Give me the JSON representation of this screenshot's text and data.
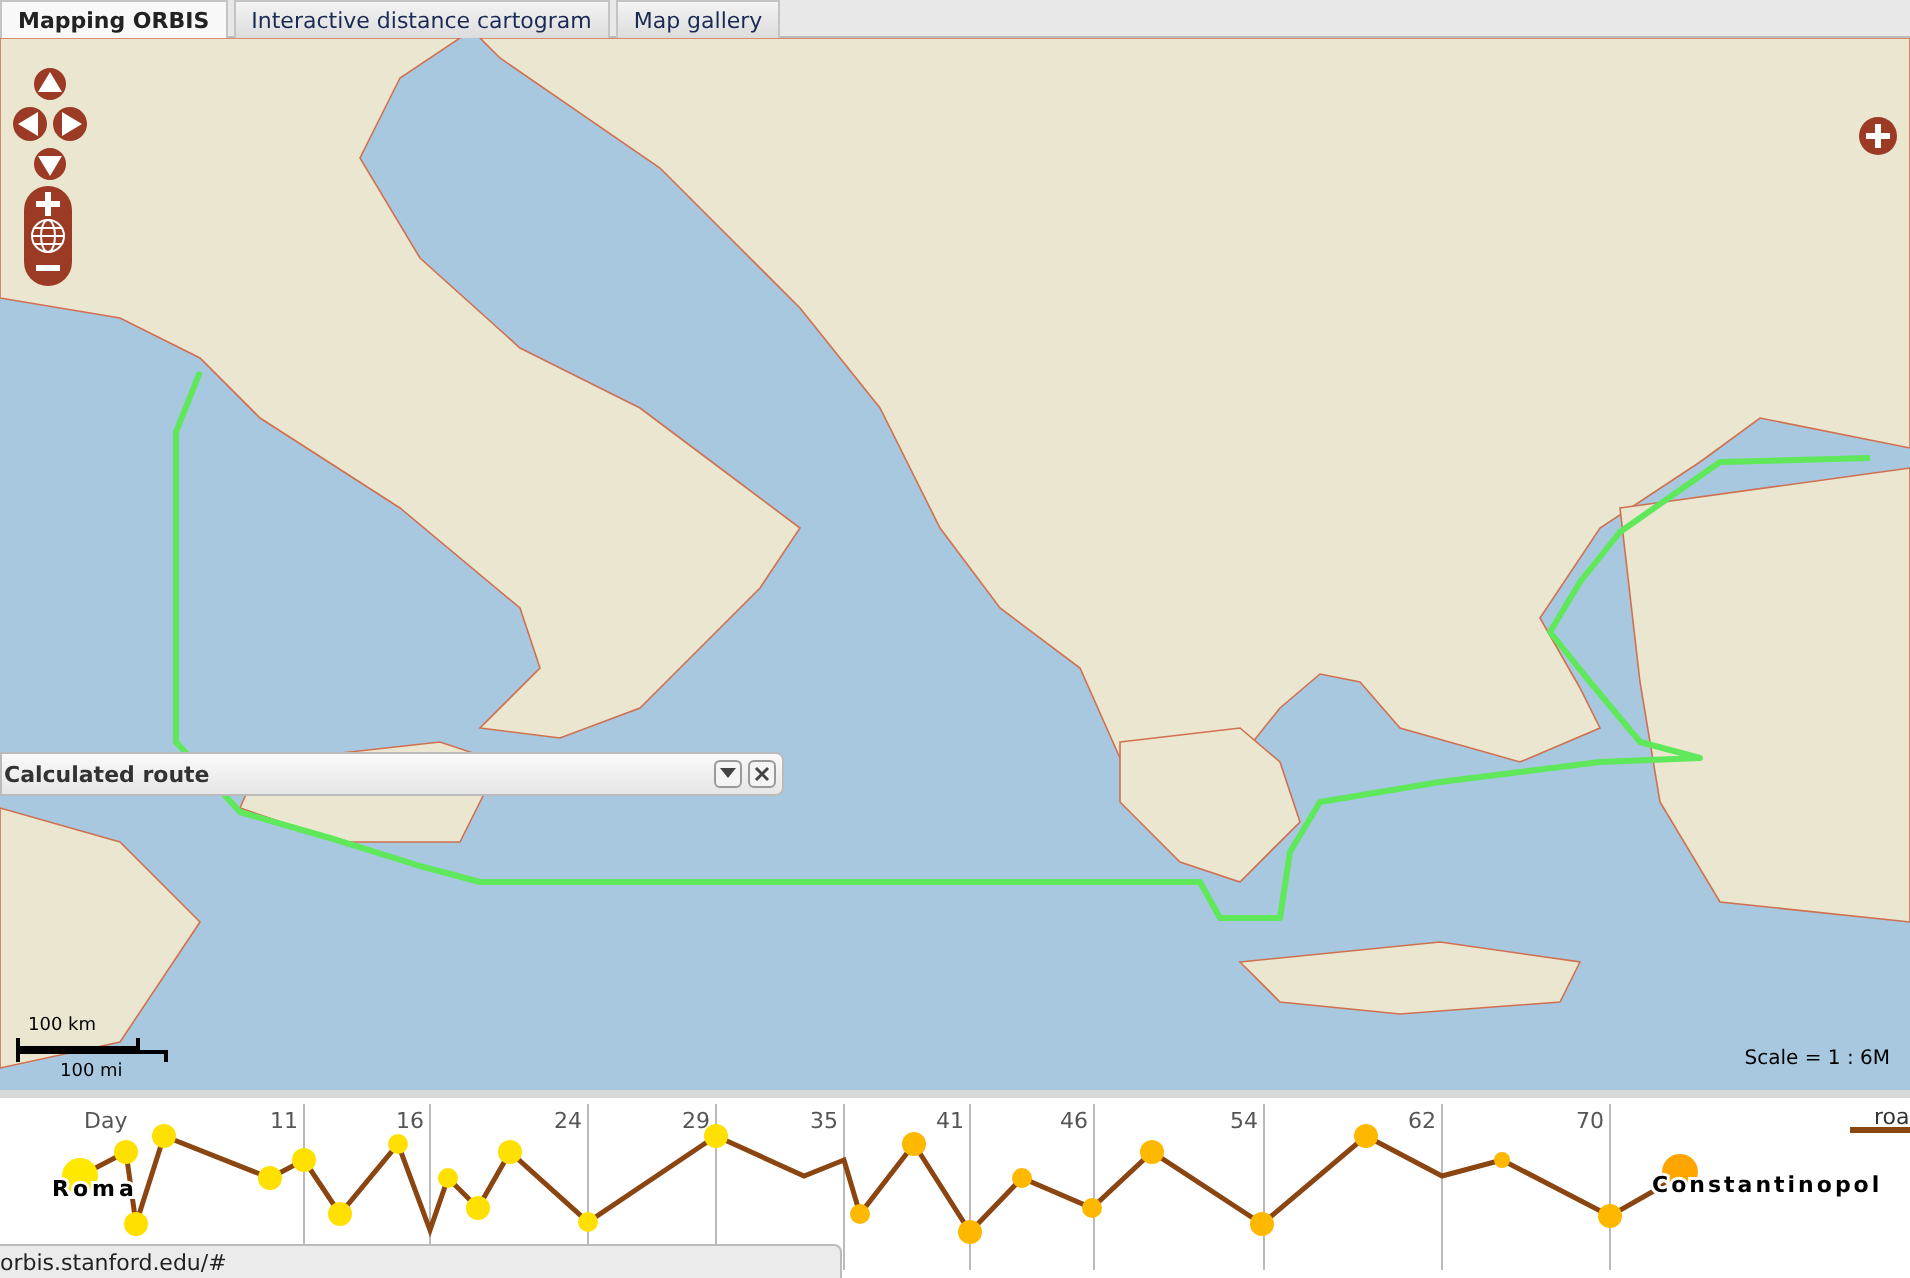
{
  "tabs": [
    {
      "label": "Mapping ORBIS",
      "selected": true
    },
    {
      "label": "Interactive distance cartogram",
      "selected": false
    },
    {
      "label": "Map gallery",
      "selected": false
    }
  ],
  "map": {
    "route_panel": {
      "title": "Calculated route"
    },
    "scale_bar": {
      "km": "100 km",
      "mi": "100 mi"
    },
    "scale": "Scale = 1 : 6M"
  },
  "timeline": {
    "axis_label": "Day",
    "ticks": [
      "11",
      "16",
      "24",
      "29",
      "35",
      "41",
      "46",
      "54",
      "62",
      "70"
    ],
    "origin": "Roma",
    "destination": "Constantinopol",
    "legend": "roa"
  },
  "status_bar": {
    "url": "orbis.stanford.edu/#"
  }
}
